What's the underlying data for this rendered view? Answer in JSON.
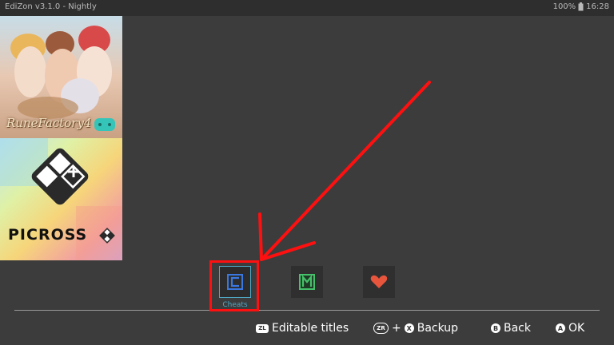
{
  "app": {
    "title": "EdiZon v3.1.0 - Nightly"
  },
  "status": {
    "battery": "100%",
    "time": "16:28"
  },
  "games": [
    {
      "title": "Rune Factory 4",
      "logo_text": "RuneFactory4"
    },
    {
      "title": "Picross S",
      "logo_text": "PICROSS"
    }
  ],
  "toolbar": {
    "cheats_label": "Cheats"
  },
  "hints": {
    "zl_glyph": "ZL",
    "editable": "Editable titles",
    "zr_glyph": "ZR",
    "plus": "+",
    "x_glyph": "X",
    "backup": "Backup",
    "b_glyph": "B",
    "back": "Back",
    "a_glyph": "A",
    "ok": "OK"
  },
  "colors": {
    "background": "#3c3c3c",
    "topbar": "#2e2e2e",
    "accent": "#4fa8c5",
    "annotation": "#ff1010",
    "memory_icon": "#46c06a",
    "favorite_icon": "#e8553d"
  }
}
